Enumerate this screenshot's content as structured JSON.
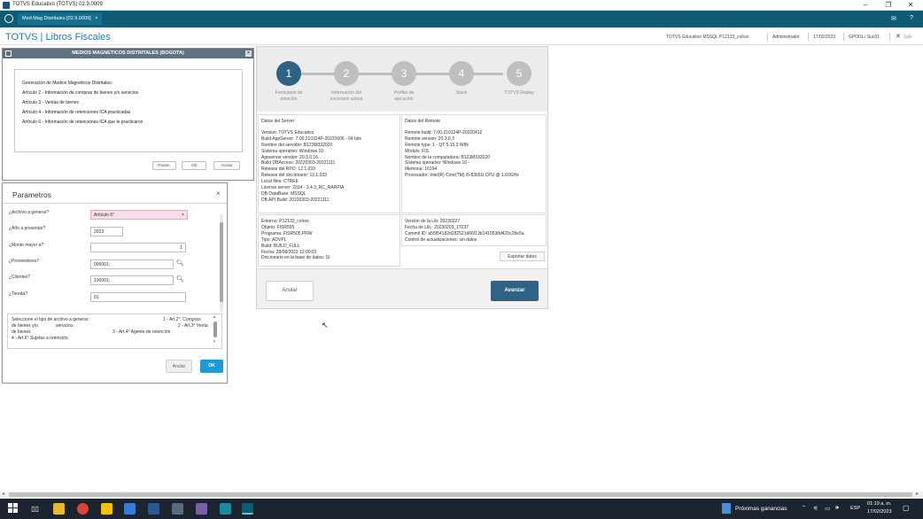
{
  "titlebar": {
    "title": "TOTVS Educativo (TOTVS) 02.9.0009"
  },
  "tabbar": {
    "tab_label": "Med Mag Distritales [02.9.0009]",
    "tab_close": "×"
  },
  "header": {
    "brand": "TOTVS | Libros Fiscales",
    "env": "TOTVS Educativo MSSQL P12133_colrox",
    "user": "Administrador",
    "date": "17/02/2023",
    "branch": "GPO01 / Suc01",
    "exit_label": "Salir"
  },
  "medios": {
    "title": "MEDIOS MAGNETICOS DISTRITALES (BOGOTA)",
    "lines": [
      "Generación de Medios Magnéticos Distritales:",
      "Artículo 2 - Información de compras de bienes y/o servicios",
      "Artículo 3 - Ventas de bienes",
      "Artículo 4 - Información de retenciones ICA practicadas",
      "Artículo 6 - Información de retenciones ICA que le practicaron"
    ],
    "btn_params": "Param.",
    "btn_ok": "Ok",
    "btn_cancel": "Anular"
  },
  "param": {
    "title": "Parametros",
    "close": "×",
    "fields": {
      "archivo": {
        "label": "¿Archivo a generar?",
        "value": "Artículo 6°"
      },
      "anio": {
        "label": "¿Año a presentar?",
        "value": "2023"
      },
      "monto": {
        "label": "¿Monto mayor a?",
        "value": "1"
      },
      "proveedores": {
        "label": "¿Proveedores?",
        "value": "000001;"
      },
      "clientes": {
        "label": "¿Clientes?",
        "value": "100001;"
      },
      "tienda": {
        "label": "¿Tienda?",
        "value": "01"
      }
    },
    "help": {
      "l1a": "Seleccione el tipo de archivo a generar:",
      "l1b": "1 - Art.2°. Compras",
      "l2a": "de bienes y/o",
      "l2b": "servicios.",
      "l2c": "2 - Art.3° Venta",
      "l3a": "de bienes",
      "l3b": "3 - Art.4° Agente de retención",
      "l4": "4 - Art.6° Sujetas a retención"
    },
    "btn_cancel": "Anular",
    "btn_ok": "OK"
  },
  "wizard": {
    "steps": [
      {
        "num": "1",
        "label1": "Formulario de",
        "label2": "atención"
      },
      {
        "num": "2",
        "label1": "Información del",
        "label2": "escenario actual"
      },
      {
        "num": "3",
        "label1": "Profiler de",
        "label2": "ejecución"
      },
      {
        "num": "4",
        "label1": "Stack",
        "label2": ""
      },
      {
        "num": "5",
        "label1": "TOTVS Replay",
        "label2": ""
      }
    ],
    "server": {
      "title": "Datos del Server",
      "lines": [
        "Version: TOTVS Educativo",
        "Build AppServer: 7.00.210324P-20220606 - 64 bits",
        "Nombre del servidor: B123M332020",
        "Sistema operativo: Windows 10",
        "Appserver version: 20.3.0.16",
        "Build DBAccess: 20220303-20221111",
        "Release del RPO: 12.1.033",
        "Release del diccionario: 12.1.033",
        "Local files: CTREE",
        "License server: 2014 - 3.4.3_RC_RARPIA",
        "DB DataBase: MSSQL",
        "DB API Build: 20220303-20221111"
      ]
    },
    "remote": {
      "title": "Datos del Remote",
      "lines": [
        "Remote build: 7.00.210324P-20220412",
        "Remote version: 20.3.0.3",
        "Remote type: 1 - QT 5.15.3 WIN",
        "Módulo: FIS",
        "Nombre de la computadora: B123M332020",
        "Sistema operativo: Windows 10 -",
        "Memoria: 16194",
        "Procesador: Intel(R) Core(TM) i5-8365U CPU @ 1.60GHz"
      ]
    },
    "env": {
      "lines": [
        "Entorno: P12133_colrox",
        "Objeto: FISR505",
        "Programa: FISR505.PRW",
        "Tipo: ADVPL",
        "Build: BUILD_FULL",
        "Fecha: 28/08/2022 12:00:01",
        "Diccionario en la base de datos: Sí"
      ]
    },
    "lib": {
      "lines": [
        "Versión de la Lib: 20230227",
        "Fecha de Lib.: 20230203_17237",
        "Commit ID: a55f54182d282521d66f13b1410538d425c28e5a",
        "Control de actualizaciones: sin datos"
      ]
    },
    "export_label": "Exportar datos",
    "btn_cancel": "Anular",
    "btn_next": "Avanzar"
  },
  "taskbar": {
    "weather": "Próximas ganancias",
    "lang": "ESP",
    "time": "01:19 a. m.",
    "date": "17/02/2023"
  },
  "colors": {
    "accent": "#2e6385",
    "header_bar": "#0f5b73",
    "brand": "#1d7fa7",
    "ok_button": "#1b9bd1"
  }
}
